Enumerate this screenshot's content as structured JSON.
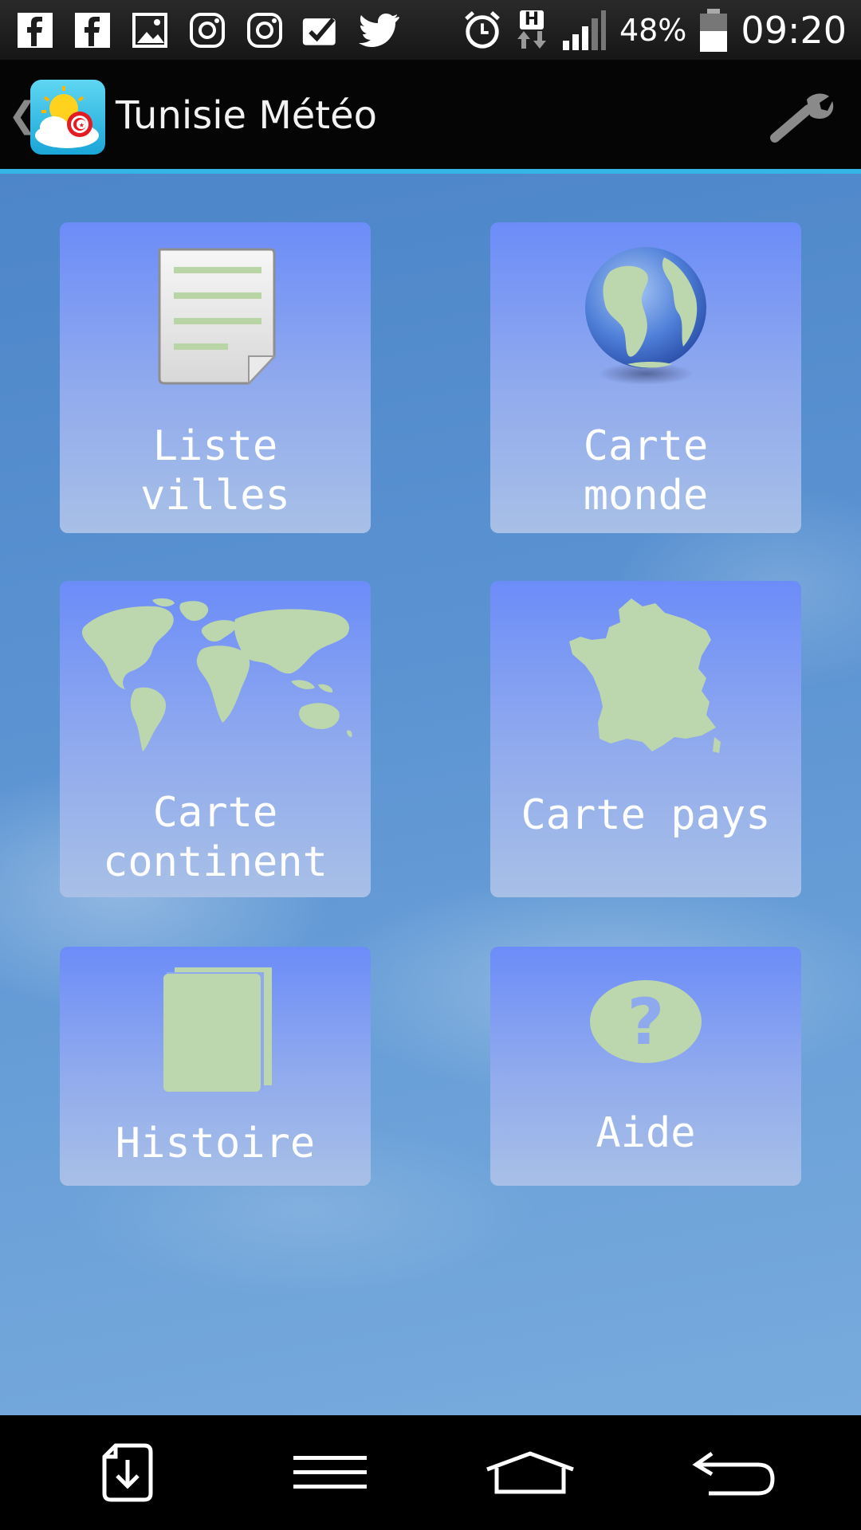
{
  "status_bar": {
    "notification_icons": [
      "facebook-icon",
      "facebook-icon",
      "gallery-icon",
      "instagram-icon",
      "instagram-icon",
      "checkbox-icon",
      "twitter-icon"
    ],
    "network_type": "H",
    "battery": "48%",
    "time": "09:20"
  },
  "action_bar": {
    "title": "Tunisie Météo",
    "back_glyph": "❮"
  },
  "tiles": [
    {
      "label": "Liste\nvilles",
      "icon": "document-icon"
    },
    {
      "label": "Carte\nmonde",
      "icon": "globe-icon"
    },
    {
      "label": "Carte\ncontinent",
      "icon": "world-map-icon"
    },
    {
      "label": "Carte pays",
      "icon": "france-map-icon"
    },
    {
      "label": "Histoire",
      "icon": "history-book-icon"
    },
    {
      "label": "Aide",
      "icon": "help-icon"
    }
  ],
  "colors": {
    "accent": "#33b5e5",
    "icon_green": "#bcd6ad",
    "tile_top": "#6c8cf8",
    "tile_bottom": "#a8c0e6"
  },
  "nav_bar": {
    "buttons": [
      "download-icon",
      "menu-icon",
      "home-icon",
      "back-icon"
    ]
  }
}
